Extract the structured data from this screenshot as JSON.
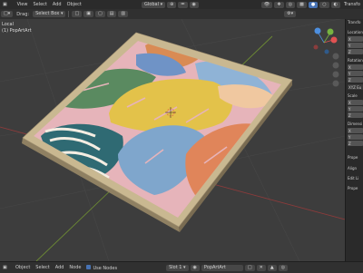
{
  "menubar": {
    "items": [
      "View",
      "Select",
      "Add",
      "Object"
    ],
    "transform_orientation": "Global",
    "props_hint": "Transfo"
  },
  "toolbar": {
    "drag_label": "Drag:",
    "select_mode": "Select Box"
  },
  "viewport": {
    "mode_label": "Local",
    "object_label": "(1) PopArtArt"
  },
  "npanel": {
    "title": "Transfo",
    "location_label": "Location",
    "rotation_label": "Rotation",
    "rotation_mode": "XYZ Eu",
    "scale_label": "Scale",
    "dimensions_label": "Dimensi",
    "axis_x": "X",
    "axis_y": "Y",
    "axis_z": "Z",
    "sections": [
      "Prope",
      "Align",
      "Edit Li",
      "Prope"
    ]
  },
  "bottom": {
    "items": [
      "Object",
      "Select",
      "Add",
      "Node"
    ],
    "use_nodes": "Use Nodes",
    "slot": "Slot 1",
    "material": "PopArtArt"
  },
  "colors": {
    "background": "#3d3d3d",
    "panel": "#2b2b2b",
    "accent": "#4772b3",
    "frame": "#c7b58e",
    "canvas_pink": "#e6b4ba"
  }
}
